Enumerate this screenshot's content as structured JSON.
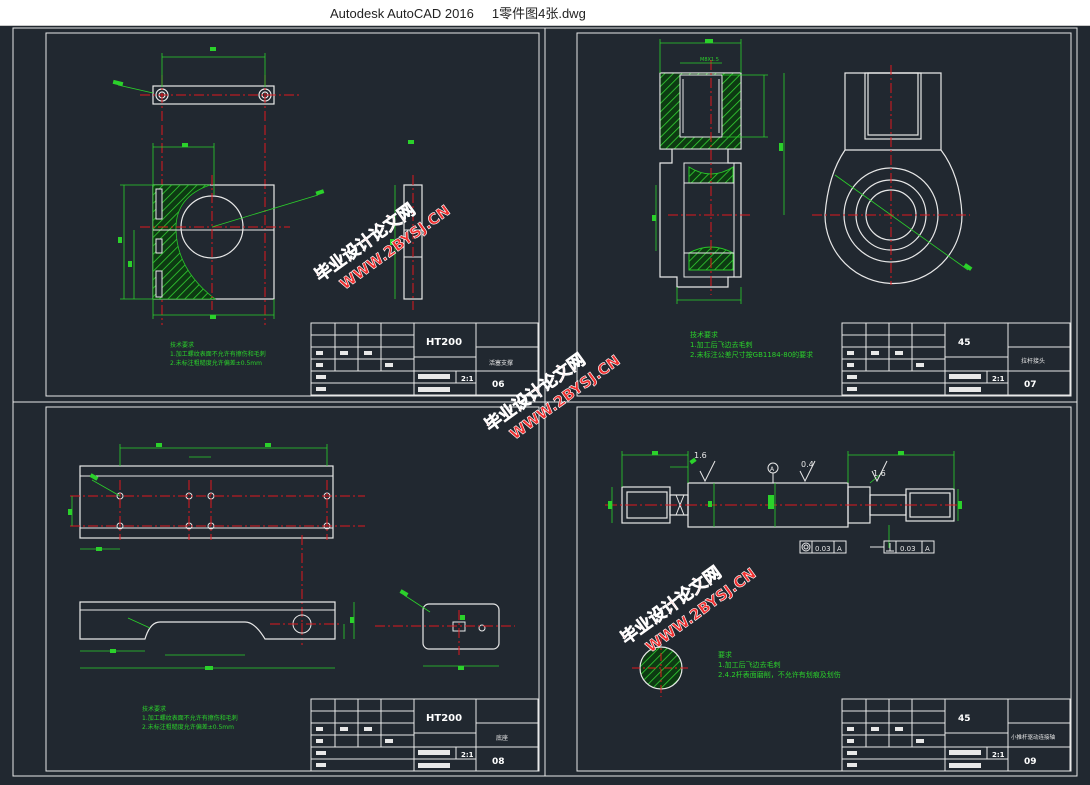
{
  "window": {
    "title": "Autodesk AutoCAD 2016     1零件图4张.dwg"
  },
  "colors": {
    "background": "#212830",
    "outline": "#e8e8e8",
    "centerline": "#e0191e",
    "dimension": "#2bd12b",
    "hatch": "#29c629",
    "watermark": "#f03030"
  },
  "watermark": {
    "line1": "毕业设计论文网",
    "line2": "WWW.2BYSJ.CN"
  },
  "sheets": [
    {
      "material": "HT200",
      "part_name": "活塞支撑",
      "number": "06",
      "scale": "2:1",
      "notes": [
        "技术要求",
        "1.加工螺纹表面不允许有擦伤和毛刺",
        "2.未标注粗糙度允许偏差±0.5mm"
      ]
    },
    {
      "material": "45",
      "part_name": "拉杆接头",
      "number": "07",
      "scale": "2:1",
      "notes": [
        "技术要求",
        "1.加工后飞边去毛刺",
        "2.未标注公差尺寸按GB1184-80的要求"
      ],
      "dim_top": "M8X1.5"
    },
    {
      "material": "HT200",
      "part_name": "底座",
      "number": "08",
      "scale": "2:1",
      "notes": [
        "技术要求",
        "1.加工螺纹表面不允许有擦伤和毛刺",
        "2.未标注粗糙度允许偏差±0.5mm"
      ]
    },
    {
      "material": "45",
      "part_name": "小推杆驱动连接轴",
      "number": "09",
      "scale": "2:1",
      "notes": [
        "要求",
        "1.加工后飞边去毛刺",
        "2.4.2杆表面磨削，不允许有划痕及划伤"
      ],
      "roughness_1": "1.6",
      "roughness_2": "0.4",
      "roughness_3": "1.6",
      "datum": "A",
      "tol_1": "0.03",
      "tol_2": "0.03",
      "tol_datum": "A"
    }
  ]
}
